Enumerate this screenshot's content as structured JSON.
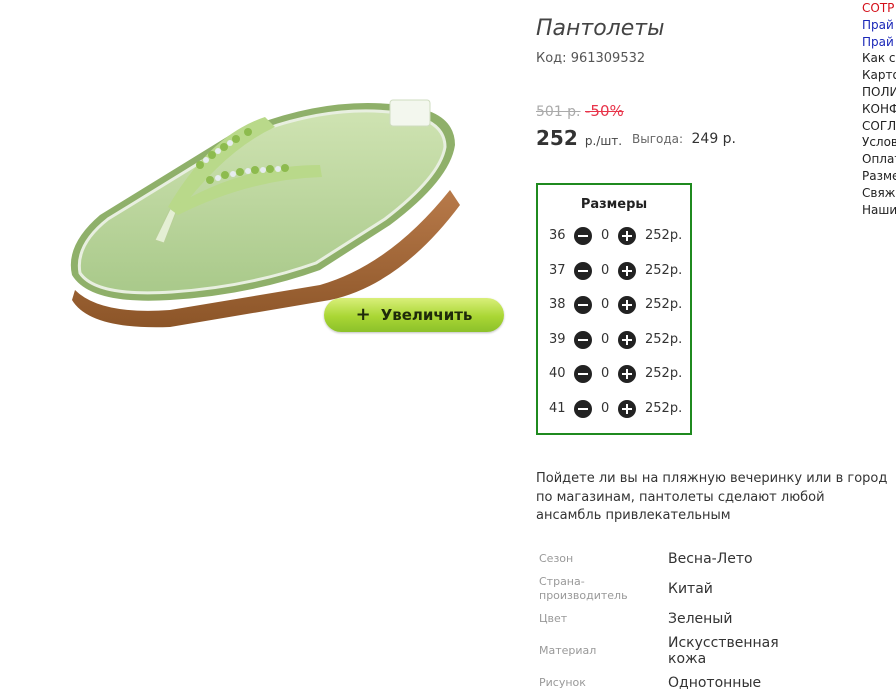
{
  "product": {
    "title": "Пантолеты",
    "code_label": "Код:",
    "code": "961309532",
    "old_price": "501 р.",
    "discount": "-50%",
    "price": "252",
    "price_unit": "р./шт.",
    "savings_label": "Выгода:",
    "savings": "249 р."
  },
  "zoom_button": {
    "label": "Увеличить",
    "icon": "plus-icon"
  },
  "sizes": {
    "title": "Размеры",
    "rows": [
      {
        "size": "36",
        "qty": "0",
        "price": "252р."
      },
      {
        "size": "37",
        "qty": "0",
        "price": "252р."
      },
      {
        "size": "38",
        "qty": "0",
        "price": "252р."
      },
      {
        "size": "39",
        "qty": "0",
        "price": "252р."
      },
      {
        "size": "40",
        "qty": "0",
        "price": "252р."
      },
      {
        "size": "41",
        "qty": "0",
        "price": "252р."
      }
    ]
  },
  "description": "Пойдете ли вы на пляжную вечеринку или в город по магазинам, пантолеты сделают любой ансамбль привлекательным",
  "attributes": [
    {
      "label": "Сезон",
      "value": "Весна-Лето"
    },
    {
      "label": "Страна-производитель",
      "value": "Китай"
    },
    {
      "label": "Цвет",
      "value": "Зеленый"
    },
    {
      "label": "Материал",
      "value": "Искусственная кожа"
    },
    {
      "label": "Рисунок",
      "value": "Однотонные"
    }
  ],
  "right_menu": [
    {
      "label": "СОТР",
      "color": "red"
    },
    {
      "label": "Прай",
      "color": "blue"
    },
    {
      "label": "Прай",
      "color": "blue"
    },
    {
      "label": "Как с",
      "color": "black"
    },
    {
      "label": "Карто",
      "color": "black"
    },
    {
      "label": "ПОЛИ",
      "color": "black"
    },
    {
      "label": "КОНФ",
      "color": "black"
    },
    {
      "label": "СОГЛ",
      "color": "black"
    },
    {
      "label": "Услов",
      "color": "black"
    },
    {
      "label": "Оплат",
      "color": "black"
    },
    {
      "label": "Разме",
      "color": "black"
    },
    {
      "label": "Свяж",
      "color": "black"
    },
    {
      "label": "Наши",
      "color": "black"
    }
  ],
  "colors": {
    "accent_green": "#1f8a1f",
    "discount_red": "#e8344a",
    "button_green": "#a9d634"
  }
}
